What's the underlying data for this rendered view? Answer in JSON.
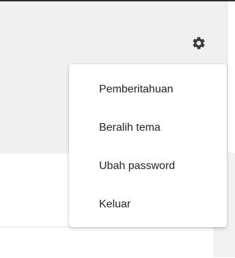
{
  "header": {
    "settings_icon": "gear-icon"
  },
  "menu": {
    "items": [
      {
        "label": "Pemberitahuan"
      },
      {
        "label": "Beralih tema"
      },
      {
        "label": "Ubah password"
      },
      {
        "label": "Keluar"
      }
    ]
  },
  "colors": {
    "panel_background": "#f0f0f0",
    "menu_background": "#ffffff",
    "icon": "#3a3a3a",
    "text": "#222222"
  }
}
